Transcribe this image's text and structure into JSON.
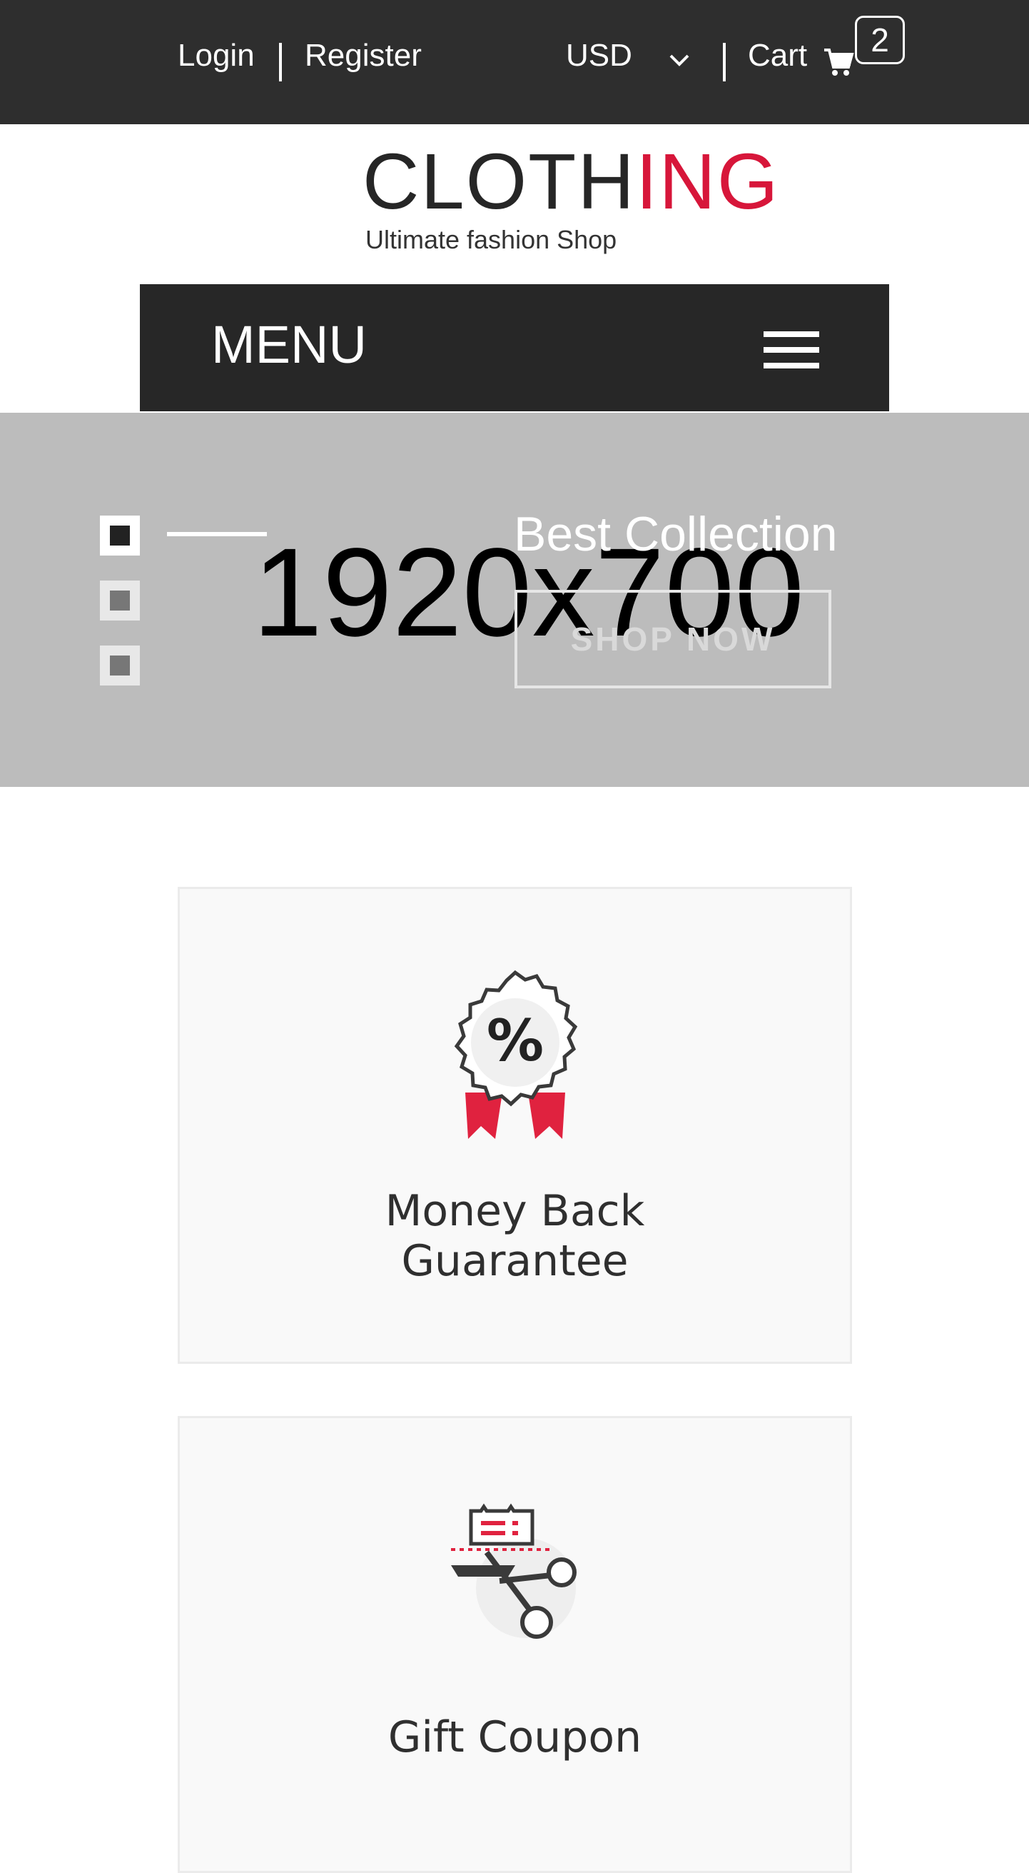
{
  "topbar": {
    "login": "Login",
    "register": "Register",
    "currency": "USD",
    "cart_label": "Cart",
    "cart_count": "2"
  },
  "logo": {
    "word_dark_1": "CLOT",
    "word_dark_2": "H",
    "word_red": "ING",
    "tagline": "Ultimate fashion Shop"
  },
  "menu": {
    "label": "MENU"
  },
  "hero": {
    "placeholder": "1920x700",
    "heading": "Best Collection",
    "button": "SHOP NOW",
    "slides_total": 3,
    "active_slide": 1
  },
  "features": [
    {
      "title_line1": "Money Back",
      "title_line2": "Guarantee",
      "icon": "discount-badge-icon"
    },
    {
      "title_line1": "Gift Coupon",
      "icon": "coupon-scissors-icon"
    }
  ],
  "colors": {
    "topbar_bg": "#2e2e2e",
    "menubar_bg": "#272727",
    "hero_bg": "#bcbcbc",
    "accent_red": "#d7163a",
    "card_bg": "#f9f9f9"
  }
}
